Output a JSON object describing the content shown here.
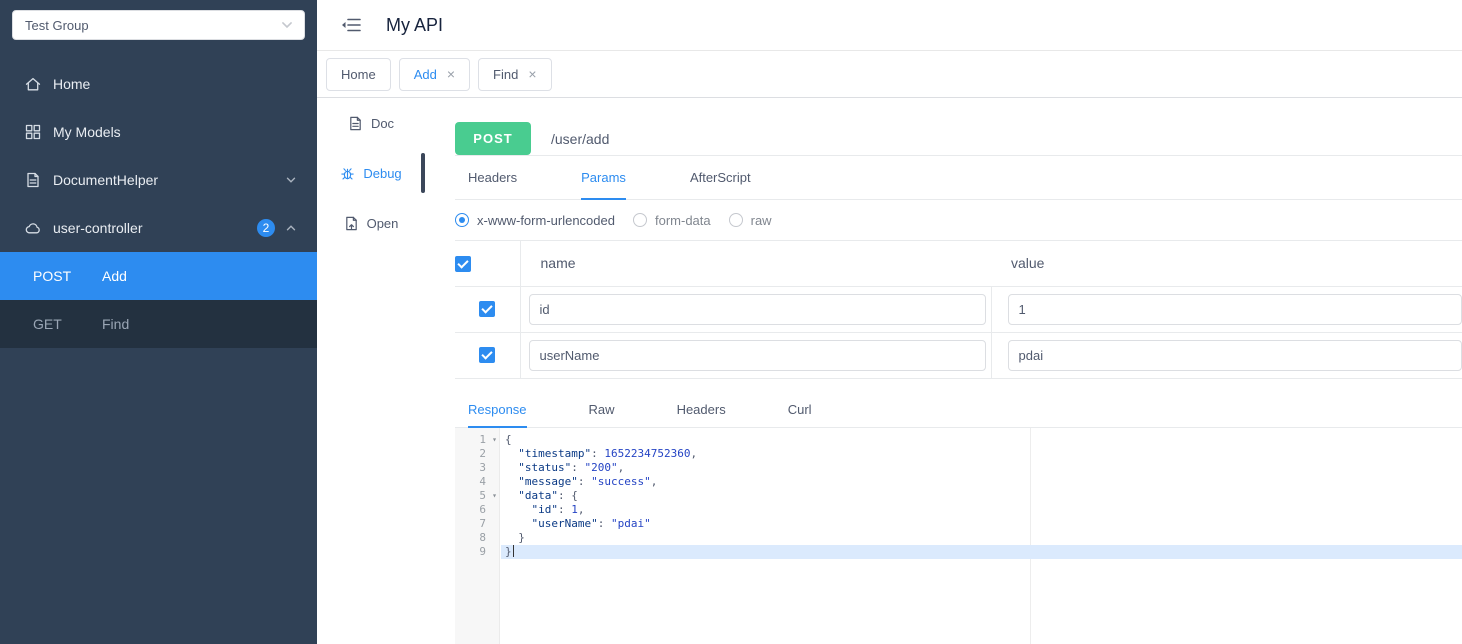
{
  "colors": {
    "accent": "#2d8cf0",
    "method_post_green": "#49cc90",
    "sidebar_bg": "#304156",
    "submenu_bg": "#233140",
    "active_line_bg": "#dbeafd",
    "gutter_bg": "#f7f7f7"
  },
  "ui_glyphs": {
    "close": "×",
    "fold": "▾"
  },
  "sidebar": {
    "group_select": {
      "value": "Test Group"
    },
    "items": [
      {
        "label": "Home",
        "icon": "home-icon"
      },
      {
        "label": "My Models",
        "icon": "models-icon"
      },
      {
        "label": "DocumentHelper",
        "icon": "document-icon",
        "chevron": "down"
      },
      {
        "label": "user-controller",
        "icon": "cloud-icon",
        "badge": "2",
        "chevron": "up"
      }
    ],
    "submenu": [
      {
        "method": "POST",
        "label": "Add",
        "active": true
      },
      {
        "method": "GET",
        "label": "Find",
        "active": false
      }
    ]
  },
  "header": {
    "title": "My API"
  },
  "doc_tabs": [
    {
      "label": "Home",
      "closable": false,
      "active": false
    },
    {
      "label": "Add",
      "closable": true,
      "active": true
    },
    {
      "label": "Find",
      "closable": true,
      "active": false
    }
  ],
  "side_tabs": [
    {
      "label": "Doc",
      "icon": "doc-icon",
      "active": false
    },
    {
      "label": "Debug",
      "icon": "bug-icon",
      "active": true
    },
    {
      "label": "Open",
      "icon": "open-icon",
      "active": false
    }
  ],
  "request": {
    "method": "POST",
    "url": "/user/add",
    "tabs": [
      {
        "label": "Headers",
        "active": false
      },
      {
        "label": "Params",
        "active": true
      },
      {
        "label": "AfterScript",
        "active": false
      }
    ],
    "body_types": [
      {
        "label": "x-www-form-urlencoded",
        "selected": true
      },
      {
        "label": "form-data",
        "selected": false
      },
      {
        "label": "raw",
        "selected": false
      }
    ],
    "params_table": {
      "columns": [
        "name",
        "value"
      ],
      "rows": [
        {
          "checked": true,
          "name": "id",
          "value": "1"
        },
        {
          "checked": true,
          "name": "userName",
          "value": "pdai"
        }
      ]
    }
  },
  "response": {
    "tabs": [
      {
        "label": "Response",
        "active": true
      },
      {
        "label": "Raw",
        "active": false
      },
      {
        "label": "Headers",
        "active": false
      },
      {
        "label": "Curl",
        "active": false
      }
    ],
    "editor_lines": [
      {
        "num": "1",
        "fold": true,
        "segments": [
          {
            "text": "{",
            "type": "punct"
          }
        ]
      },
      {
        "num": "2",
        "segments": [
          {
            "text": "  ",
            "type": "punct"
          },
          {
            "text": "\"timestamp\"",
            "type": "key"
          },
          {
            "text": ": ",
            "type": "punct"
          },
          {
            "text": "1652234752360",
            "type": "number"
          },
          {
            "text": ",",
            "type": "punct"
          }
        ]
      },
      {
        "num": "3",
        "segments": [
          {
            "text": "  ",
            "type": "punct"
          },
          {
            "text": "\"status\"",
            "type": "key"
          },
          {
            "text": ": ",
            "type": "punct"
          },
          {
            "text": "\"200\"",
            "type": "string"
          },
          {
            "text": ",",
            "type": "punct"
          }
        ]
      },
      {
        "num": "4",
        "segments": [
          {
            "text": "  ",
            "type": "punct"
          },
          {
            "text": "\"message\"",
            "type": "key"
          },
          {
            "text": ": ",
            "type": "punct"
          },
          {
            "text": "\"success\"",
            "type": "string"
          },
          {
            "text": ",",
            "type": "punct"
          }
        ]
      },
      {
        "num": "5",
        "fold": true,
        "segments": [
          {
            "text": "  ",
            "type": "punct"
          },
          {
            "text": "\"data\"",
            "type": "key"
          },
          {
            "text": ": {",
            "type": "punct"
          }
        ]
      },
      {
        "num": "6",
        "segments": [
          {
            "text": "    ",
            "type": "punct"
          },
          {
            "text": "\"id\"",
            "type": "key"
          },
          {
            "text": ": ",
            "type": "punct"
          },
          {
            "text": "1",
            "type": "number"
          },
          {
            "text": ",",
            "type": "punct"
          }
        ]
      },
      {
        "num": "7",
        "segments": [
          {
            "text": "    ",
            "type": "punct"
          },
          {
            "text": "\"userName\"",
            "type": "key"
          },
          {
            "text": ": ",
            "type": "punct"
          },
          {
            "text": "\"pdai\"",
            "type": "string"
          }
        ]
      },
      {
        "num": "8",
        "segments": [
          {
            "text": "  }",
            "type": "punct"
          }
        ]
      },
      {
        "num": "9",
        "active": true,
        "cursor": true,
        "segments": [
          {
            "text": "}",
            "type": "punct"
          }
        ]
      }
    ]
  }
}
